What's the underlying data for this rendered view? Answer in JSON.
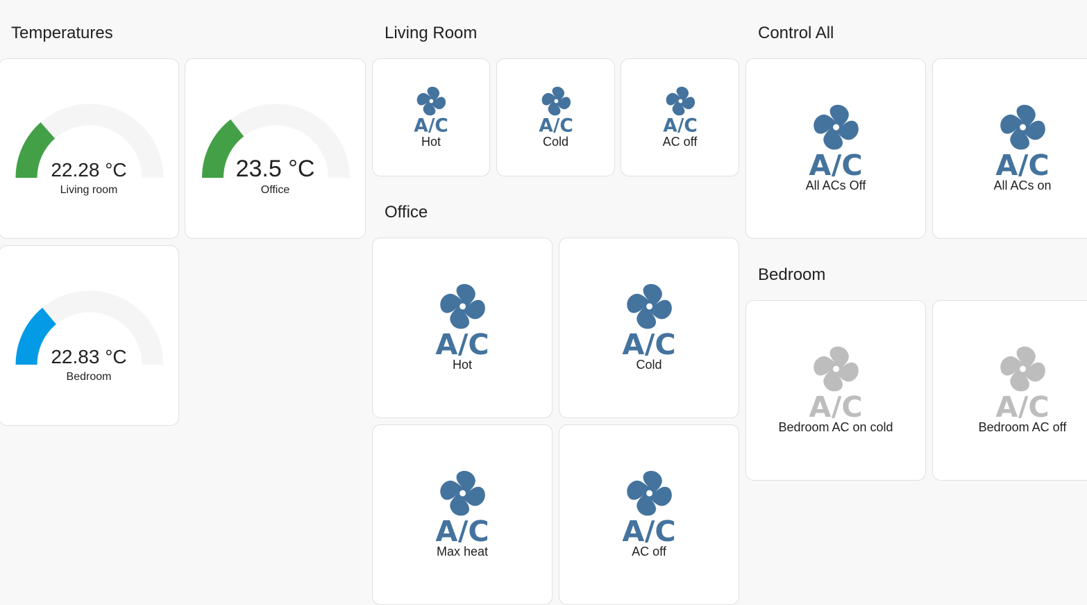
{
  "sections": {
    "temperatures": "Temperatures",
    "living_room": "Living Room",
    "office": "Office",
    "control_all": "Control All",
    "bedroom": "Bedroom"
  },
  "gauges": [
    {
      "value": "22.28 °C",
      "name": "Living room",
      "level": 0.27,
      "color": "#43a047"
    },
    {
      "value": "23.5 °C",
      "name": "Office",
      "level": 0.29,
      "color": "#43a047"
    },
    {
      "value": "22.83 °C",
      "name": "Bedroom",
      "level": 0.28,
      "color": "#039be5"
    }
  ],
  "living_room": [
    "Hot",
    "Cold",
    "AC off"
  ],
  "office": [
    "Hot",
    "Cold",
    "Max heat",
    "AC off"
  ],
  "control_all": [
    "All ACs Off",
    "All ACs on"
  ],
  "bedroom": [
    "Bedroom AC on cold",
    "Bedroom AC off"
  ],
  "icon": {
    "name": "air-conditioner-icon",
    "text": "A/C",
    "active_color": "#44739e",
    "inactive_color": "#bdbdbd"
  }
}
